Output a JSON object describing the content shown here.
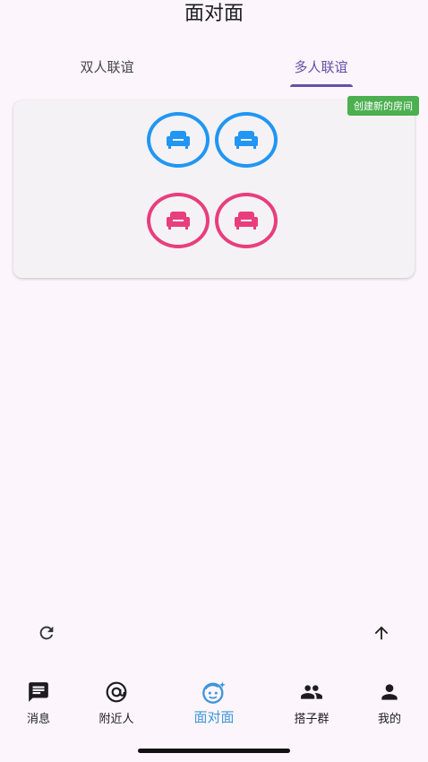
{
  "page": {
    "title": "面对面"
  },
  "tabs": [
    {
      "label": "双人联谊",
      "selected": false
    },
    {
      "label": "多人联谊",
      "selected": true
    }
  ],
  "room": {
    "create_badge": "创建新的房间",
    "seats": [
      {
        "icon": "sofa-icon",
        "color": "#2196f3"
      },
      {
        "icon": "sofa-icon",
        "color": "#2196f3"
      },
      {
        "icon": "sofa-icon",
        "color": "#e83e7c"
      },
      {
        "icon": "sofa-icon",
        "color": "#e83e7c"
      }
    ]
  },
  "actions": {
    "refresh_icon": "refresh-icon",
    "up_icon": "arrow-up-icon"
  },
  "nav": {
    "items": [
      {
        "label": "消息",
        "icon": "chat-icon",
        "active": false
      },
      {
        "label": "附近人",
        "icon": "at-icon",
        "active": false
      },
      {
        "label": "面对面",
        "icon": "face-icon",
        "active": true
      },
      {
        "label": "搭子群",
        "icon": "group-icon",
        "active": false
      },
      {
        "label": "我的",
        "icon": "person-icon",
        "active": false
      }
    ]
  },
  "colors": {
    "accent": "#6750a4",
    "badge": "#4caf50",
    "seat_male": "#2196f3",
    "seat_female": "#e83e7c",
    "nav_active": "#3f95d8"
  }
}
